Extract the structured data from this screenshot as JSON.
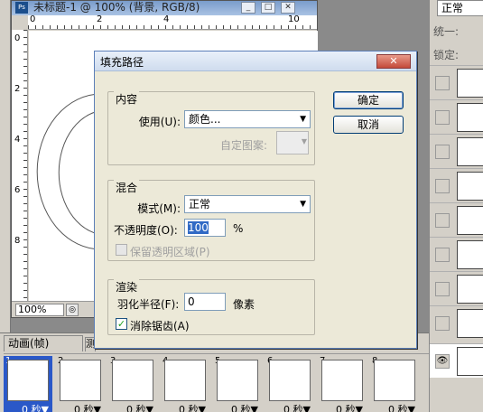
{
  "document": {
    "title": "未标题-1 @ 100% (背景, RGB/8)",
    "ps_icon": "Ps",
    "ruler_top": [
      "0",
      "2",
      "4",
      "10"
    ],
    "ruler_left": [
      "0",
      "2",
      "4",
      "6",
      "8"
    ],
    "zoom": "100%"
  },
  "right_panel": {
    "blend_mode": "正常",
    "unify_label": "统一:",
    "lock_label": "锁定:"
  },
  "animation": {
    "tab_label": "动画(帧)",
    "tab2_label": "测",
    "frames": [
      {
        "num": "1",
        "delay": "0 秒▼"
      },
      {
        "num": "2",
        "delay": "0 秒▼"
      },
      {
        "num": "3",
        "delay": "0 秒▼"
      },
      {
        "num": "4",
        "delay": "0 秒▼"
      },
      {
        "num": "5",
        "delay": "0 秒▼"
      },
      {
        "num": "6",
        "delay": "0 秒▼"
      },
      {
        "num": "7",
        "delay": "0 秒▼"
      },
      {
        "num": "8",
        "delay": "0 秒▼"
      }
    ]
  },
  "dialog": {
    "title": "填充路径",
    "content_group": "内容",
    "use_label": "使用(U):",
    "use_value": "颜色...",
    "custom_pattern_label": "自定图案:",
    "blend_group": "混合",
    "mode_label": "模式(M):",
    "mode_value": "正常",
    "opacity_label": "不透明度(O):",
    "opacity_value": "100",
    "opacity_unit": "%",
    "preserve_label": "保留透明区域(P)",
    "render_group": "渲染",
    "feather_label": "羽化半径(F):",
    "feather_value": "0",
    "feather_unit": "像素",
    "antialias_label": "消除锯齿(A)",
    "ok_label": "确定",
    "cancel_label": "取消"
  }
}
